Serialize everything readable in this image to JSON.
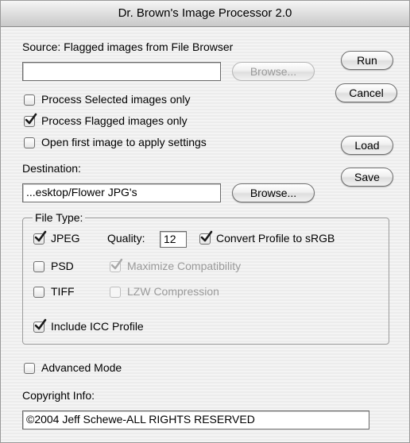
{
  "window": {
    "title": "Dr. Brown's Image Processor 2.0"
  },
  "source": {
    "label": "Source: Flagged images from File Browser",
    "path_value": "",
    "browse_label": "Browse..."
  },
  "options": {
    "process_selected": {
      "label": "Process Selected images only",
      "checked": false
    },
    "process_flagged": {
      "label": "Process Flagged images only",
      "checked": true
    },
    "open_first": {
      "label": "Open first image to apply settings",
      "checked": false
    }
  },
  "destination": {
    "label": "Destination:",
    "path_value": "...esktop/Flower JPG's",
    "browse_label": "Browse..."
  },
  "side_buttons": {
    "run": "Run",
    "cancel": "Cancel",
    "load": "Load",
    "save": "Save"
  },
  "file_type": {
    "title": "File Type:",
    "jpeg": {
      "label": "JPEG",
      "checked": true
    },
    "quality_label": "Quality:",
    "quality_value": "12",
    "convert_profile": {
      "label": "Convert Profile to sRGB",
      "checked": true
    },
    "psd": {
      "label": "PSD",
      "checked": false
    },
    "maximize_compat": {
      "label": "Maximize Compatibility",
      "checked": true,
      "enabled": false
    },
    "tiff": {
      "label": "TIFF",
      "checked": false
    },
    "lzw": {
      "label": "LZW Compression",
      "checked": false,
      "enabled": false
    },
    "icc": {
      "label": "Include ICC Profile",
      "checked": true
    }
  },
  "advanced": {
    "label": "Advanced Mode",
    "checked": false
  },
  "copyright": {
    "label": "Copyright Info:",
    "value": "©2004 Jeff Schewe-ALL RIGHTS RESERVED"
  },
  "colors": {
    "check_mark": "#1a1a1a",
    "disabled_text": "#9a9a9a",
    "border": "#6b6b6b"
  },
  "icons": {
    "check": "check-mark-icon"
  }
}
